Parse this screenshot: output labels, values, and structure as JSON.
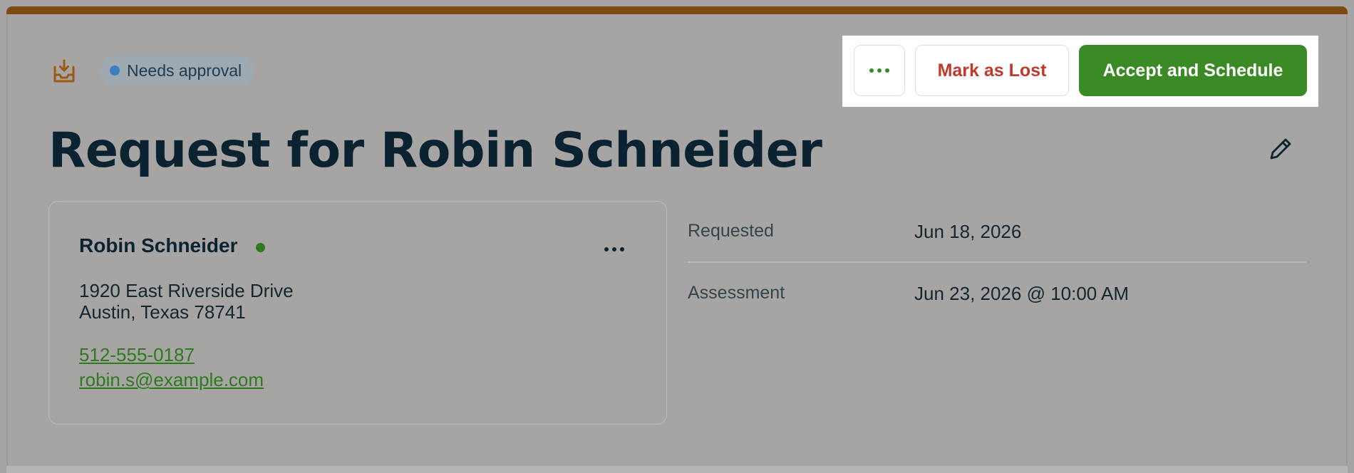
{
  "status_badge": {
    "label": "Needs approval"
  },
  "actions": {
    "more_icon": "ellipsis-icon",
    "mark_lost_label": "Mark as Lost",
    "accept_label": "Accept and Schedule"
  },
  "title": "Request for Robin Schneider",
  "client": {
    "name": "Robin Schneider",
    "address_line1": "1920 East Riverside Drive",
    "address_line2": "Austin, Texas 78741",
    "phone": "512-555-0187",
    "email": "robin.s@example.com"
  },
  "details": [
    {
      "label": "Requested",
      "value": "Jun 18, 2026"
    },
    {
      "label": "Assessment",
      "value": "Jun 23, 2026 @ 10:00 AM"
    }
  ],
  "colors": {
    "brand_bar": "#7c4a12",
    "accept_green": "#3a8a26",
    "lost_red": "#c0392b",
    "badge_dot": "#3a7fc0",
    "online_dot": "#2f7a1f"
  }
}
